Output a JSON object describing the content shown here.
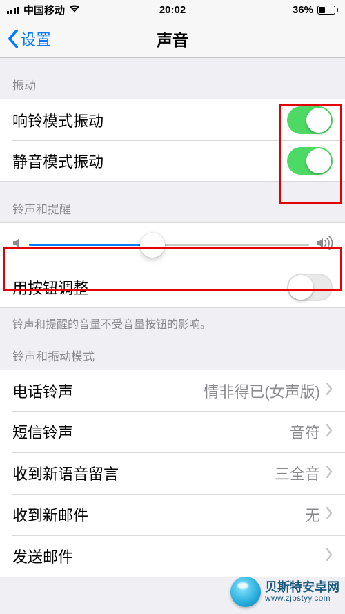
{
  "status": {
    "carrier": "中国移动",
    "time": "20:02",
    "battery_pct": "36%"
  },
  "nav": {
    "back_label": "设置",
    "title": "声音"
  },
  "sections": {
    "vibration": {
      "header": "振动",
      "ring_vibrate": {
        "label": "响铃模式振动",
        "on": true
      },
      "silent_vibrate": {
        "label": "静音模式振动",
        "on": true
      }
    },
    "ringer": {
      "header": "铃声和提醒",
      "slider_value_pct": 44,
      "adjust_with_buttons": {
        "label": "用按钮调整",
        "on": false
      },
      "footnote": "铃声和提醒的音量不受音量按钮的影响。"
    },
    "patterns": {
      "header": "铃声和振动模式",
      "items": [
        {
          "label": "电话铃声",
          "value": "情非得已(女声版)"
        },
        {
          "label": "短信铃声",
          "value": "音符"
        },
        {
          "label": "收到新语音留言",
          "value": "三全音"
        },
        {
          "label": "收到新邮件",
          "value": "无"
        },
        {
          "label": "发送邮件",
          "value": ""
        }
      ]
    }
  },
  "watermark": {
    "zh": "贝斯特安卓网",
    "en": "www.zjbstyy.com"
  }
}
